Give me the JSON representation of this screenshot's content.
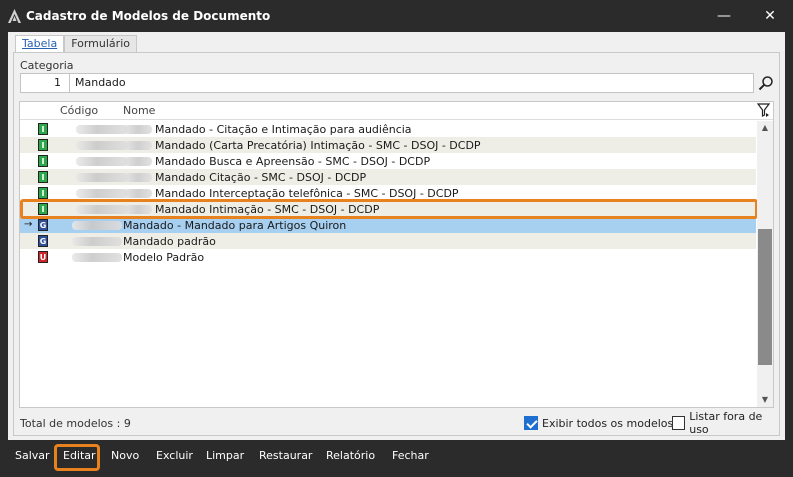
{
  "window": {
    "title": "Cadastro de Modelos de Documento",
    "minimize_glyph": "—",
    "close_glyph": "✕"
  },
  "tabs": [
    {
      "label": "Tabela",
      "active": true
    },
    {
      "label": "Formulário",
      "active": false
    }
  ],
  "category": {
    "label": "Categoria",
    "id": "1",
    "name": "Mandado"
  },
  "grid": {
    "columns": {
      "code": "Código",
      "name": "Nome"
    },
    "rows": [
      {
        "type": "I",
        "name": "Mandado - Citação e Intimação para audiência",
        "alt": false,
        "selected": false
      },
      {
        "type": "I",
        "name": "Mandado (Carta Precatória) Intimação - SMC - DSOJ - DCDP",
        "alt": true,
        "selected": false
      },
      {
        "type": "I",
        "name": "Mandado Busca e Apreensão - SMC - DSOJ - DCDP",
        "alt": false,
        "selected": false
      },
      {
        "type": "I",
        "name": "Mandado Citação - SMC - DSOJ - DCDP",
        "alt": true,
        "selected": false
      },
      {
        "type": "I",
        "name": "Mandado Interceptação telefônica - SMC - DSOJ - DCDP",
        "alt": false,
        "selected": false
      },
      {
        "type": "I",
        "name": "Mandado Intimação - SMC - DSOJ - DCDP",
        "alt": true,
        "selected": false
      },
      {
        "type": "G",
        "name": "Mandado - Mandado para Artigos Quiron",
        "alt": false,
        "selected": true
      },
      {
        "type": "G",
        "name": "Mandado padrão",
        "alt": true,
        "selected": false
      },
      {
        "type": "U",
        "name": "Modelo Padrão",
        "alt": false,
        "selected": false
      }
    ],
    "current_row_indicator": "→"
  },
  "footer": {
    "total_label": "Total de modelos : 9",
    "show_all_label": "Exibir todos os modelos",
    "show_all_checked": true,
    "list_out_of_use_label": "Listar fora de uso",
    "list_out_of_use_checked": false
  },
  "toolbar": {
    "buttons": [
      {
        "label": "Salvar",
        "key": "S"
      },
      {
        "label": "Editar",
        "key": "d"
      },
      {
        "label": "Novo",
        "key": "N"
      },
      {
        "label": "Excluir",
        "key": "E"
      },
      {
        "label": "Limpar",
        "key": "L"
      },
      {
        "label": "Restaurar",
        "key": "R"
      },
      {
        "label": "Relatório",
        "key": "ó"
      },
      {
        "label": "Fechar",
        "key": "F"
      }
    ]
  },
  "colors": {
    "badge_I": "#2aa84a",
    "badge_G": "#2c4f9e",
    "badge_U": "#d2232a",
    "highlight": "#e8821e",
    "selected_row": "#a7cff0"
  }
}
